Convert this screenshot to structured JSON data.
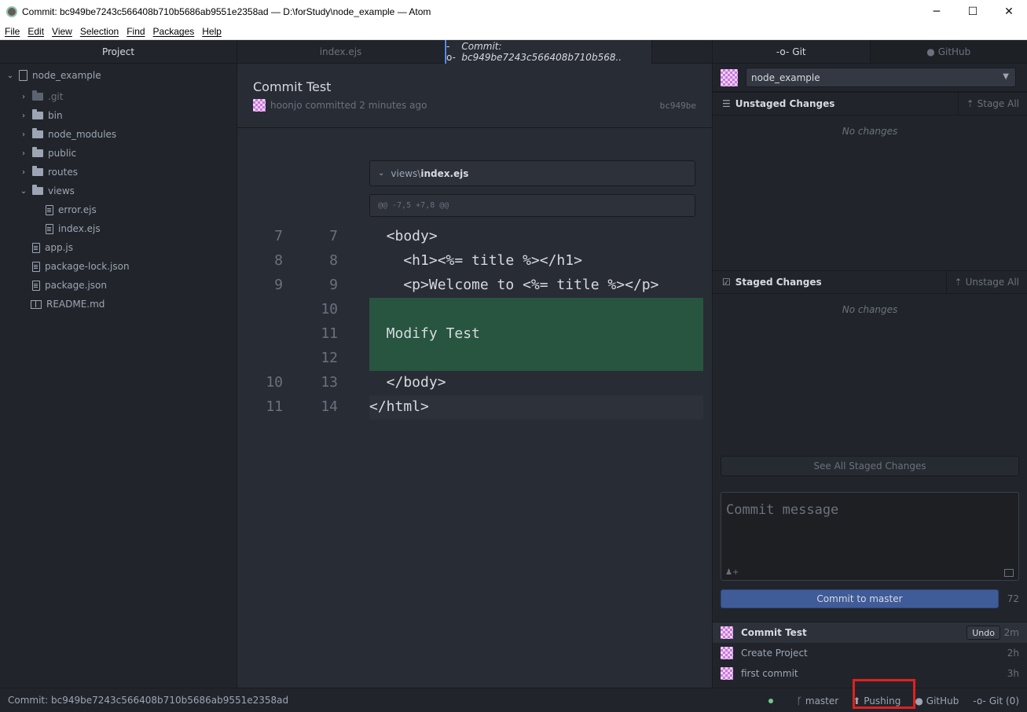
{
  "window": {
    "title": "Commit: bc949be7243c566408b710b5686ab9551e2358ad — D:\\forStudy\\node_example — Atom",
    "minimize": "─",
    "maximize": "☐",
    "close": "✕"
  },
  "menu": [
    "File",
    "Edit",
    "View",
    "Selection",
    "Find",
    "Packages",
    "Help"
  ],
  "tree": {
    "header": "Project",
    "root": "node_example",
    "items": [
      {
        "label": ".git",
        "type": "folder",
        "expanded": false
      },
      {
        "label": "bin",
        "type": "folder",
        "expanded": false
      },
      {
        "label": "node_modules",
        "type": "folder",
        "expanded": false
      },
      {
        "label": "public",
        "type": "folder",
        "expanded": false
      },
      {
        "label": "routes",
        "type": "folder",
        "expanded": false
      },
      {
        "label": "views",
        "type": "folder",
        "expanded": true
      },
      {
        "label": "error.ejs",
        "type": "file"
      },
      {
        "label": "index.ejs",
        "type": "file"
      },
      {
        "label": "app.js",
        "type": "file"
      },
      {
        "label": "package-lock.json",
        "type": "file"
      },
      {
        "label": "package.json",
        "type": "file"
      },
      {
        "label": "README.md",
        "type": "book"
      }
    ]
  },
  "editor": {
    "tabs": [
      {
        "label": "index.ejs",
        "active": false
      },
      {
        "label": "Commit: bc949be7243c566408b710b568..",
        "active": true
      }
    ],
    "commit": {
      "title": "Commit Test",
      "meta": "hoonjo committed 2 minutes ago",
      "short_sha": "bc949be"
    },
    "file_header_dir": "views\\",
    "file_header_name": "index.ejs",
    "hunk_header": "@@ -7,5 +7,8 @@",
    "lines": [
      {
        "old": "7",
        "new": "7",
        "code": "  <body>",
        "kind": "context"
      },
      {
        "old": "8",
        "new": "8",
        "code": "    <h1><%= title %></h1>",
        "kind": "context"
      },
      {
        "old": "9",
        "new": "9",
        "code": "    <p>Welcome to <%= title %></p>",
        "kind": "context"
      },
      {
        "old": "",
        "new": "10",
        "code": "",
        "kind": "added"
      },
      {
        "old": "",
        "new": "11",
        "code": "  Modify Test",
        "kind": "added"
      },
      {
        "old": "",
        "new": "12",
        "code": "",
        "kind": "added"
      },
      {
        "old": "10",
        "new": "13",
        "code": "  </body>",
        "kind": "context"
      },
      {
        "old": "11",
        "new": "14",
        "code": "</html>",
        "kind": "cursor"
      }
    ]
  },
  "git": {
    "tabs": [
      "Git",
      "GitHub"
    ],
    "repo": "node_example",
    "unstaged": {
      "label": "Unstaged Changes",
      "action": "Stage All",
      "empty": "No changes"
    },
    "staged": {
      "label": "Staged Changes",
      "action": "Unstage All",
      "empty": "No changes"
    },
    "see_all": "See All Staged Changes",
    "message_placeholder": "Commit message",
    "commit_button": "Commit to master",
    "char_count": "72",
    "recent_commits": [
      {
        "message": "Commit Test",
        "time": "2m",
        "undo": "Undo"
      },
      {
        "message": "Create Project",
        "time": "2h"
      },
      {
        "message": "first commit",
        "time": "3h"
      }
    ]
  },
  "status": {
    "left": "Commit: bc949be7243c566408b710b5686ab9551e2358ad",
    "branch": "master",
    "push": "Pushing",
    "github": "GitHub",
    "git": "Git (0)"
  },
  "colors": {
    "accent": "#568af2",
    "added_bg": "#275540",
    "commit_button": "#3f5b98",
    "highlight_box": "#e02020"
  }
}
